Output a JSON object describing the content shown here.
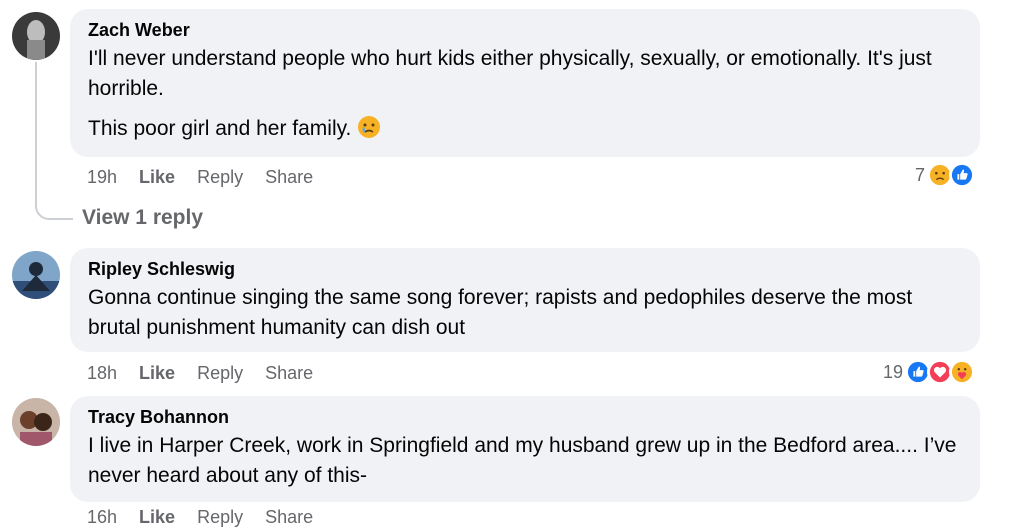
{
  "comments": [
    {
      "name": "Zach Weber",
      "para1": "I'll never understand people who hurt kids either physically, sexually, or emotionally. It's just horrible.",
      "para2": "This poor girl and her family.",
      "para2_emoji": "crying-face-emoji",
      "time": "19h",
      "like": "Like",
      "reply": "Reply",
      "share": "Share",
      "reaction_count": "7",
      "reactions": [
        "sad",
        "like"
      ],
      "view_replies": "View 1 reply"
    },
    {
      "name": "Ripley Schleswig",
      "text": "Gonna continue singing the same song forever; rapists and pedophiles deserve the most brutal punishment humanity can dish out",
      "time": "18h",
      "like": "Like",
      "reply": "Reply",
      "share": "Share",
      "reaction_count": "19",
      "reactions": [
        "like",
        "love",
        "care"
      ]
    },
    {
      "name": "Tracy Bohannon",
      "text": "I live in Harper Creek, work in Springfield and my husband grew up in the Bedford area.... I’ve never heard about any of this-",
      "time": "16h",
      "like": "Like",
      "reply": "Reply",
      "share": "Share"
    }
  ],
  "colors": {
    "bubble": "#f0f2f5",
    "secondary_text": "#65676b",
    "like_blue": "#1877f2",
    "love_red": "#f33e58",
    "emoji_yellow": "#f7b125"
  }
}
